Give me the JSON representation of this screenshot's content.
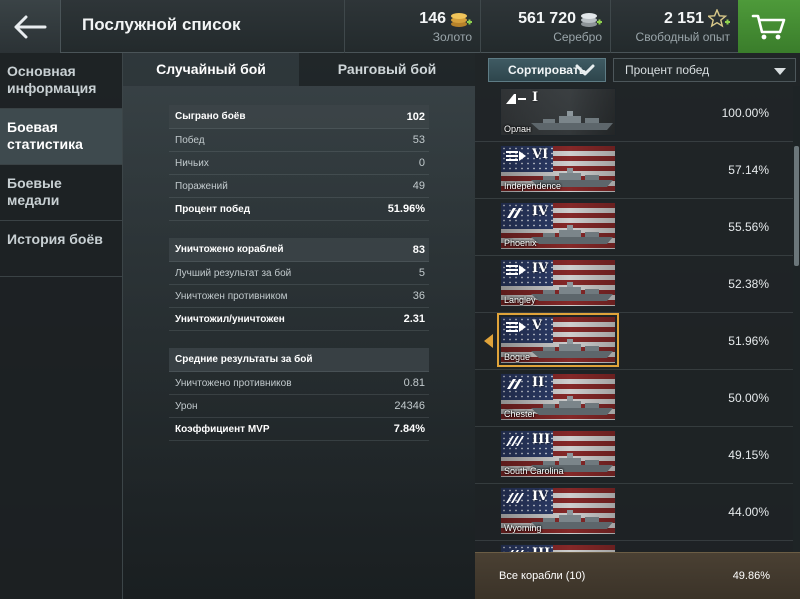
{
  "header": {
    "title": "Послужной список",
    "gold": {
      "amount": "146",
      "label": "Золото"
    },
    "silver": {
      "amount": "561 720",
      "label": "Серебро"
    },
    "free_xp": {
      "amount": "2 151",
      "label": "Свободный опыт"
    }
  },
  "sidebar": {
    "items": [
      {
        "label": "Основная информация",
        "active": false
      },
      {
        "label": "Боевая статистика",
        "active": true
      },
      {
        "label": "Боевые медали",
        "active": false
      },
      {
        "label": "История боёв",
        "active": false
      }
    ]
  },
  "tabs": [
    {
      "label": "Случайный бой",
      "active": true
    },
    {
      "label": "Ранговый бой",
      "active": false
    }
  ],
  "stats": {
    "group1": [
      {
        "label": "Сыграно боёв",
        "value": "102",
        "style": "head"
      },
      {
        "label": "Побед",
        "value": "53",
        "style": "normal"
      },
      {
        "label": "Ничьих",
        "value": "0",
        "style": "normal"
      },
      {
        "label": "Поражений",
        "value": "49",
        "style": "normal"
      },
      {
        "label": "Процент побед",
        "value": "51.96%",
        "style": "bold"
      }
    ],
    "group2": [
      {
        "label": "Уничтожено кораблей",
        "value": "83",
        "style": "head"
      },
      {
        "label": "Лучший результат за бой",
        "value": "5",
        "style": "normal"
      },
      {
        "label": "Уничтожен противником",
        "value": "36",
        "style": "normal"
      },
      {
        "label": "Уничтожил/уничтожен",
        "value": "2.31",
        "style": "bold"
      }
    ],
    "group3": [
      {
        "label": "Средние результаты за бой",
        "value": "",
        "style": "head"
      },
      {
        "label": "Уничтожено противников",
        "value": "0.81",
        "style": "normal"
      },
      {
        "label": "Урон",
        "value": "24346",
        "style": "normal"
      },
      {
        "label": "Коэффициент MVP",
        "value": "7.84%",
        "style": "bold"
      }
    ]
  },
  "ship_panel": {
    "sort_label": "Сортировать",
    "sort_select": "Процент побед",
    "ships": [
      {
        "name": "Орлан",
        "tier": "I",
        "nation": "ussr",
        "class": "destroyer",
        "win_rate": "100.00%",
        "selected": false
      },
      {
        "name": "Independence",
        "tier": "VI",
        "nation": "usa",
        "class": "carrier",
        "win_rate": "57.14%",
        "selected": false
      },
      {
        "name": "Phoenix",
        "tier": "IV",
        "nation": "usa",
        "class": "cruiser",
        "win_rate": "55.56%",
        "selected": false
      },
      {
        "name": "Langley",
        "tier": "IV",
        "nation": "usa",
        "class": "carrier",
        "win_rate": "52.38%",
        "selected": false
      },
      {
        "name": "Bogue",
        "tier": "V",
        "nation": "usa",
        "class": "carrier",
        "win_rate": "51.96%",
        "selected": true
      },
      {
        "name": "Chester",
        "tier": "II",
        "nation": "usa",
        "class": "cruiser",
        "win_rate": "50.00%",
        "selected": false
      },
      {
        "name": "South Carolina",
        "tier": "III",
        "nation": "usa",
        "class": "battleship",
        "win_rate": "49.15%",
        "selected": false
      },
      {
        "name": "Wyoming",
        "tier": "IV",
        "nation": "usa",
        "class": "battleship",
        "win_rate": "44.00%",
        "selected": false
      },
      {
        "name": "",
        "tier": "III",
        "nation": "usa",
        "class": "battleship",
        "win_rate": "",
        "selected": false
      }
    ],
    "summary_label": "Все корабли (10)",
    "summary_value": "49.86%"
  },
  "colors": {
    "accent_gold": "#e0a33a",
    "cart_green": "#3a7d2b",
    "sort_button": "#2e464d"
  }
}
